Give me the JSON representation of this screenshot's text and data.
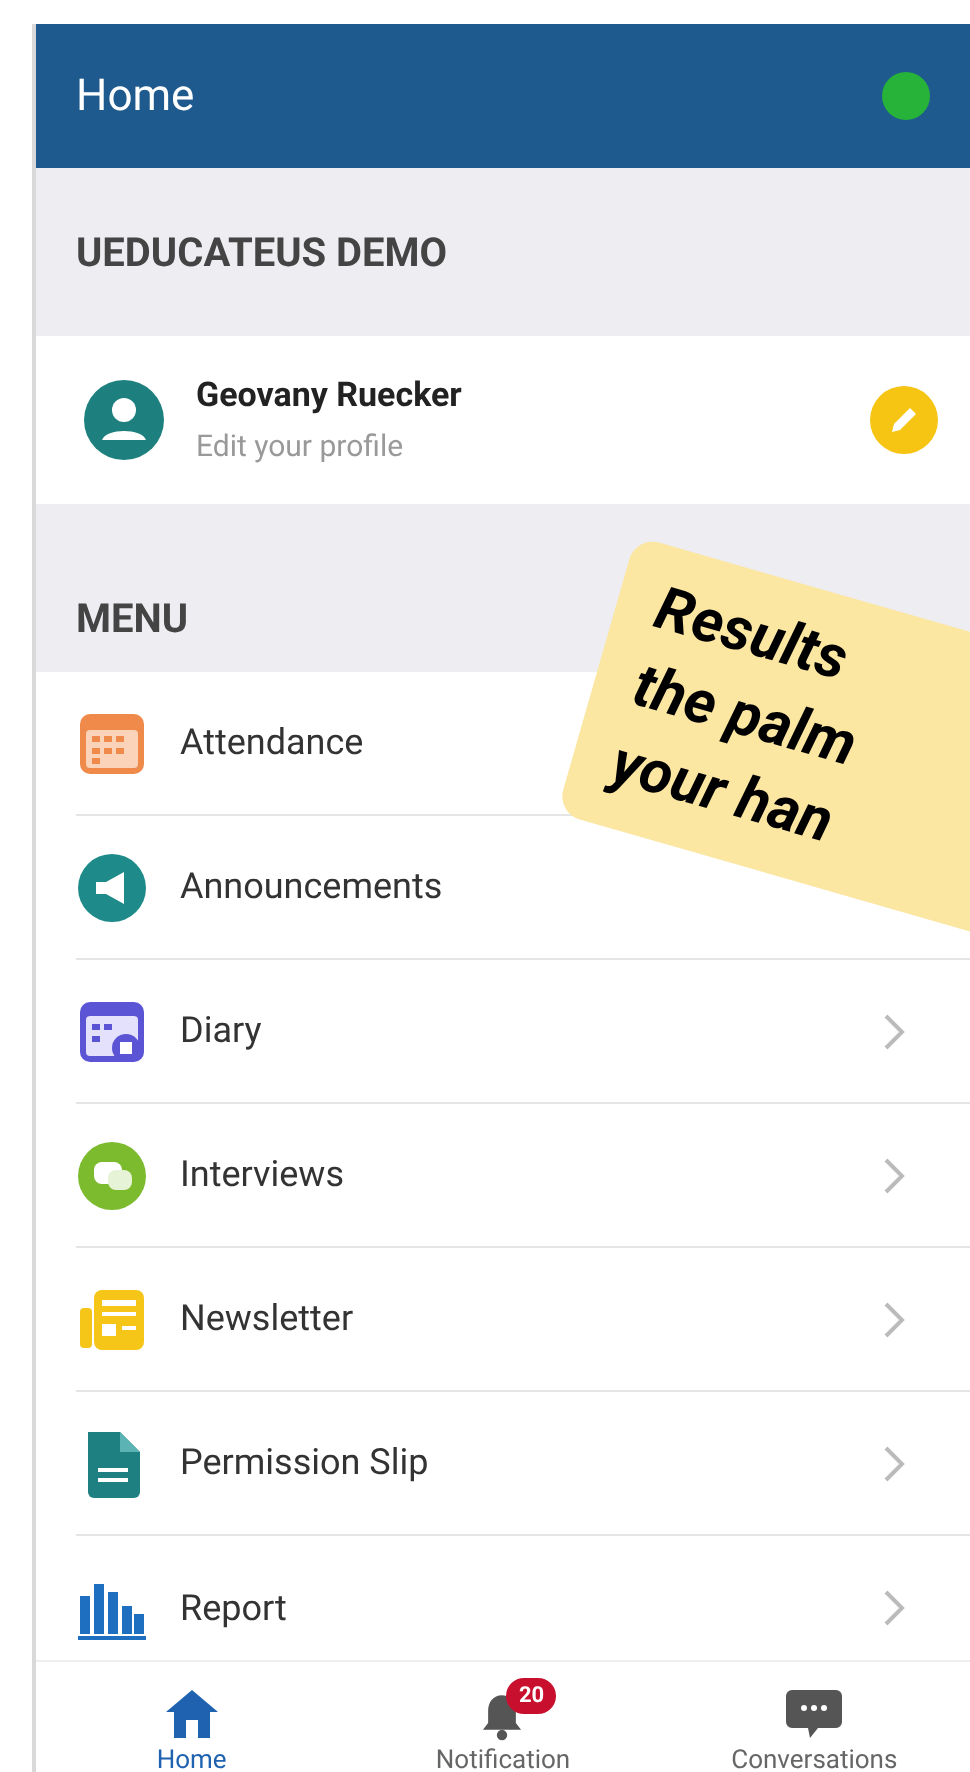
{
  "header": {
    "title": "Home",
    "online": true
  },
  "school": {
    "name": "UEDUCATEUS DEMO"
  },
  "profile": {
    "name": "Geovany Ruecker",
    "subtitle": "Edit your profile"
  },
  "menu": {
    "title": "MENU",
    "items": [
      {
        "label": "Attendance",
        "kind": "plain"
      },
      {
        "label": "Announcements",
        "kind": "plain"
      },
      {
        "label": "Diary",
        "kind": "link"
      },
      {
        "label": "Interviews",
        "kind": "link"
      },
      {
        "label": "Newsletter",
        "kind": "link"
      },
      {
        "label": "Permission Slip",
        "kind": "link"
      },
      {
        "label": "Report",
        "kind": "link"
      }
    ]
  },
  "callout": {
    "lines": [
      "Results",
      "the palm",
      "your han"
    ]
  },
  "bottom_nav": [
    {
      "label": "Home",
      "selected": true
    },
    {
      "label": "Notification",
      "selected": false,
      "badge": "20"
    },
    {
      "label": "Conversations",
      "selected": false
    }
  ]
}
